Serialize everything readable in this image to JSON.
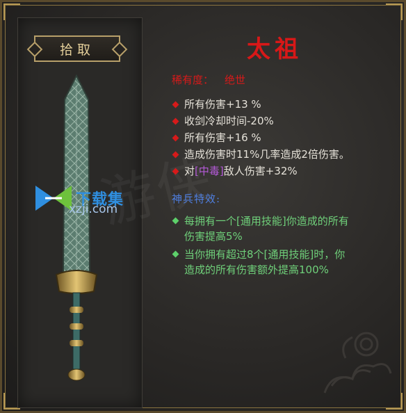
{
  "pickup_label": "拾取",
  "item_name": "太祖",
  "rarity": {
    "label": "稀有度：",
    "value": "绝世"
  },
  "stats": [
    {
      "pre": "所有伤害+13 %",
      "hl": "",
      "post": ""
    },
    {
      "pre": "收剑冷却时间-20%",
      "hl": "",
      "post": ""
    },
    {
      "pre": "所有伤害+16 %",
      "hl": "",
      "post": ""
    },
    {
      "pre": "造成伤害时11%几率造成2倍伤害。",
      "hl": "",
      "post": ""
    },
    {
      "pre": "对",
      "hl": "[中毒]",
      "post": "敌人伤害+32%"
    }
  ],
  "special_title": "神兵特效:",
  "effects": [
    {
      "l1": "每拥有一个[通用技能]你造成的所有",
      "l2": "伤害提高5%"
    },
    {
      "l1": "当你拥有超过8个[通用技能]时，你",
      "l2": "造成的所有伤害额外提高100%"
    }
  ],
  "watermark": {
    "name": "下载集",
    "url": "xzji.com"
  },
  "colors": {
    "title": "#d81818",
    "rarity": "#d61a1a",
    "special": "#4f7fe0",
    "effect": "#6fd07a",
    "poison": "#b45ad8",
    "gold": "#b8a06a"
  }
}
